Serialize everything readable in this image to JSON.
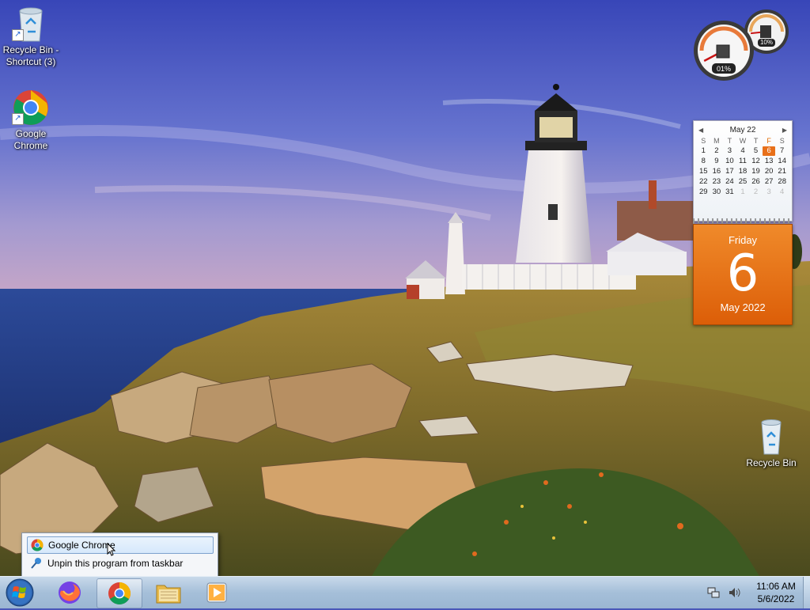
{
  "desktop": {
    "icons": [
      {
        "label": "Recycle Bin - Shortcut (3)",
        "icon": "recycle-bin-icon"
      },
      {
        "label": "Google Chrome",
        "icon": "chrome-icon"
      },
      {
        "label": "Recycle Bin",
        "icon": "recycle-bin-icon"
      }
    ]
  },
  "gadgets": {
    "cpu_meter": {
      "cpu_percent": "01%",
      "memory_percent": "10%",
      "cpu_value": 0.01,
      "memory_value": 0.1
    },
    "calendar": {
      "month_label": "May 22",
      "weekdays": [
        "S",
        "M",
        "T",
        "W",
        "T",
        "F",
        "S"
      ],
      "weeks": [
        [
          "1",
          "2",
          "3",
          "4",
          "5",
          "6",
          "7"
        ],
        [
          "8",
          "9",
          "10",
          "11",
          "12",
          "13",
          "14"
        ],
        [
          "15",
          "16",
          "17",
          "18",
          "19",
          "20",
          "21"
        ],
        [
          "22",
          "23",
          "24",
          "25",
          "26",
          "27",
          "28"
        ],
        [
          "29",
          "30",
          "31",
          "1",
          "2",
          "3",
          "4"
        ]
      ],
      "day_name": "Friday",
      "day_number": "6",
      "month_year": "May 2022"
    }
  },
  "jump_list": {
    "items": [
      {
        "label": "Google Chrome",
        "icon": "chrome-icon"
      },
      {
        "label": "Unpin this program from taskbar",
        "icon": "unpin-icon"
      }
    ]
  },
  "taskbar": {
    "pinned": [
      {
        "name": "firefox",
        "icon": "firefox-icon"
      },
      {
        "name": "chrome",
        "icon": "chrome-icon"
      },
      {
        "name": "file-explorer",
        "icon": "folder-icon"
      },
      {
        "name": "media-player",
        "icon": "media-player-icon"
      }
    ],
    "tray": {
      "time": "11:06 AM",
      "date": "5/6/2022"
    }
  }
}
